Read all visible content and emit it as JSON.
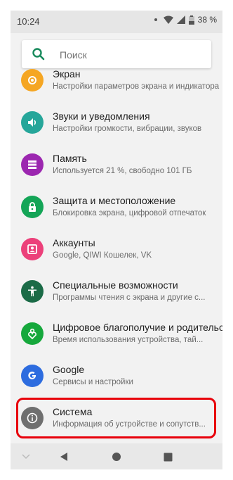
{
  "status_bar": {
    "time": "10:24",
    "battery": "38 %"
  },
  "search": {
    "placeholder": "Поиск"
  },
  "items": [
    {
      "icon": "display-icon",
      "color": "#f5a623",
      "title": "Экран",
      "subtitle": "Настройки параметров экрана и индикатора"
    },
    {
      "icon": "sound-icon",
      "color": "#26a69a",
      "title": "Звуки и уведомления",
      "subtitle": "Настройки громкости, вибрации, звуков"
    },
    {
      "icon": "storage-icon",
      "color": "#9c27b0",
      "title": "Память",
      "subtitle": "Используется 21 %, свободно 101 ГБ"
    },
    {
      "icon": "lock-icon",
      "color": "#14a557",
      "title": "Защита и местоположение",
      "subtitle": "Блокировка экрана, цифровой отпечаток"
    },
    {
      "icon": "account-icon",
      "color": "#ec407a",
      "title": "Аккаунты",
      "subtitle": "Google, QIWI Кошелек, VK"
    },
    {
      "icon": "accessibility-icon",
      "color": "#1b6b47",
      "title": "Специальные возможности",
      "subtitle": "Программы чтения с экрана и другие с..."
    },
    {
      "icon": "wellbeing-icon",
      "color": "#16a83c",
      "title": "Цифровое благополучие и родительс...",
      "subtitle": "Время использования устройства, тай..."
    },
    {
      "icon": "google-icon",
      "color": "#2d6cdf",
      "title": "Google",
      "subtitle": "Сервисы и настройки"
    },
    {
      "icon": "info-icon",
      "color": "#6f6f6f",
      "title": "Система",
      "subtitle": "Информация об устройстве и сопутств..."
    }
  ]
}
